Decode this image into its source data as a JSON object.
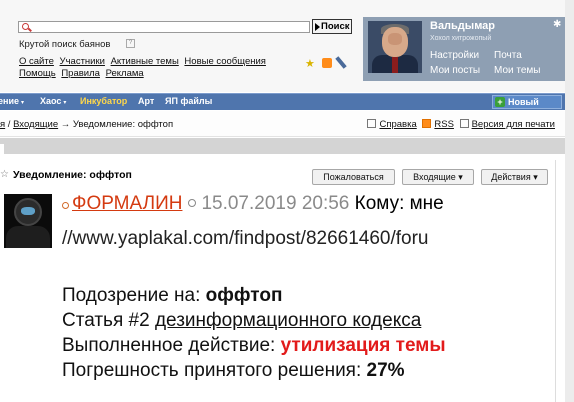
{
  "search": {
    "placeholder": "",
    "button_label": "Поиск"
  },
  "baian_link": "Крутой поиск баянов",
  "nav_links_row1": [
    "О сайте",
    "Участники",
    "Активные темы",
    "Новые сообщения"
  ],
  "nav_links_row2": [
    "Помощь",
    "Правила",
    "Реклама"
  ],
  "user": {
    "name": "Вальдымар",
    "subtitle": "Хохол хитрожопый",
    "links": {
      "settings": "Настройки",
      "mail": "Почта",
      "my_posts": "Мои посты",
      "my_themes": "Мои темы"
    }
  },
  "navbar": {
    "items": [
      {
        "label": "ение",
        "caret": "▾"
      },
      {
        "label": "Хаос",
        "caret": "▾"
      },
      {
        "label": "Инкубатор",
        "caret": ""
      },
      {
        "label": "Арт",
        "caret": ""
      },
      {
        "label": "ЯП файлы",
        "caret": ""
      }
    ],
    "new_post": "Новый пост",
    "accent": "#4f75ad"
  },
  "breadcrumb": {
    "prefix": "я",
    "sep1": " / ",
    "inbox": "Входящие",
    "arrow": " → ",
    "current": "Уведомление: оффтоп"
  },
  "tools": {
    "help": "Справка",
    "rss": "RSS",
    "print": "Версия для печати"
  },
  "message": {
    "title": "Уведомление: оффтоп",
    "buttons": {
      "complain": "Пожаловаться",
      "inbox": "Входящие ▾",
      "actions": "Действия ▾"
    },
    "author": "ФОРМАЛИН",
    "date": "15.07.2019 20:56",
    "to_label": "Кому: мне",
    "link_text": "//www.yaplakal.com/findpost/82661460/foru",
    "suspicion_label": "Подозрение на: ",
    "suspicion_value": "оффтоп",
    "article_label": "Статья #2 ",
    "article_value": "дезинформационного кодекса",
    "action_label": "Выполненное действие: ",
    "action_value": "утилизация темы",
    "error_label": "Погрешность принятого решения: ",
    "error_value": "27%"
  },
  "colors": {
    "author": "#d43a10",
    "action": "#e21b1b",
    "date": "#8a8a8a"
  }
}
